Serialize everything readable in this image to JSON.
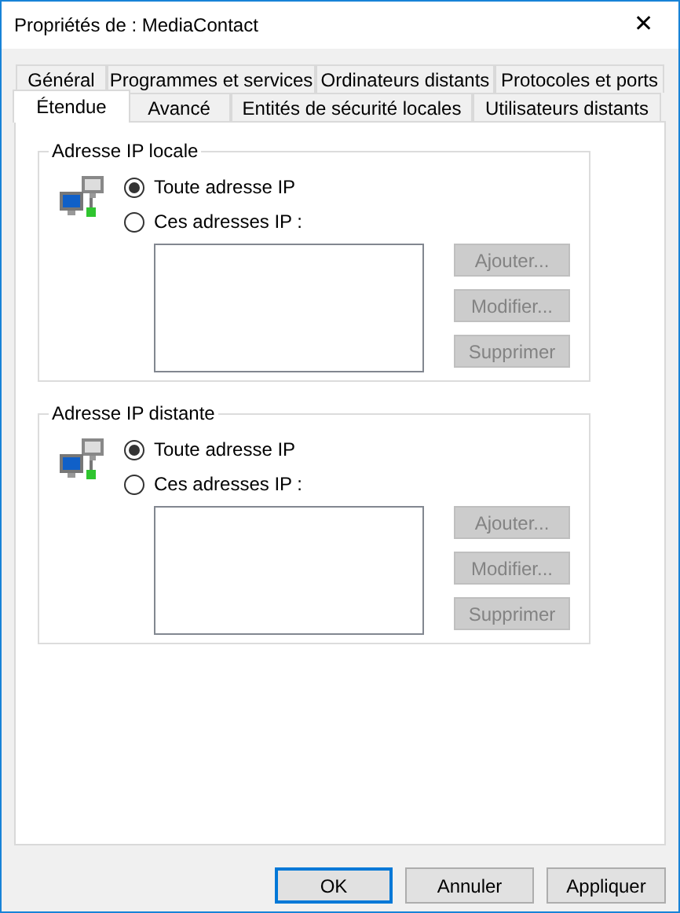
{
  "window": {
    "title": "Propriétés de : MediaContact",
    "close": "✕"
  },
  "tab_rows": [
    [
      {
        "label": "Général",
        "selected": false
      },
      {
        "label": "Programmes et services",
        "selected": false
      },
      {
        "label": "Ordinateurs distants",
        "selected": false
      },
      {
        "label": "Protocoles et ports",
        "selected": false
      }
    ],
    [
      {
        "label": "Étendue",
        "selected": true
      },
      {
        "label": "Avancé",
        "selected": false
      },
      {
        "label": "Entités de sécurité locales",
        "selected": false
      },
      {
        "label": "Utilisateurs distants",
        "selected": false
      }
    ]
  ],
  "groups": [
    {
      "title": "Adresse IP locale",
      "options": [
        {
          "label": "Toute adresse IP",
          "selected": true
        },
        {
          "label": "Ces adresses IP :",
          "selected": false
        }
      ],
      "buttons": [
        {
          "label": "Ajouter...",
          "disabled": true
        },
        {
          "label": "Modifier...",
          "disabled": true
        },
        {
          "label": "Supprimer",
          "disabled": true
        }
      ]
    },
    {
      "title": "Adresse IP distante",
      "options": [
        {
          "label": "Toute adresse IP",
          "selected": true
        },
        {
          "label": "Ces adresses IP :",
          "selected": false
        }
      ],
      "buttons": [
        {
          "label": "Ajouter...",
          "disabled": true
        },
        {
          "label": "Modifier...",
          "disabled": true
        },
        {
          "label": "Supprimer",
          "disabled": true
        }
      ]
    }
  ],
  "buttons": [
    {
      "label": "OK",
      "default": true
    },
    {
      "label": "Annuler",
      "default": false
    },
    {
      "label": "Appliquer",
      "default": false
    }
  ]
}
